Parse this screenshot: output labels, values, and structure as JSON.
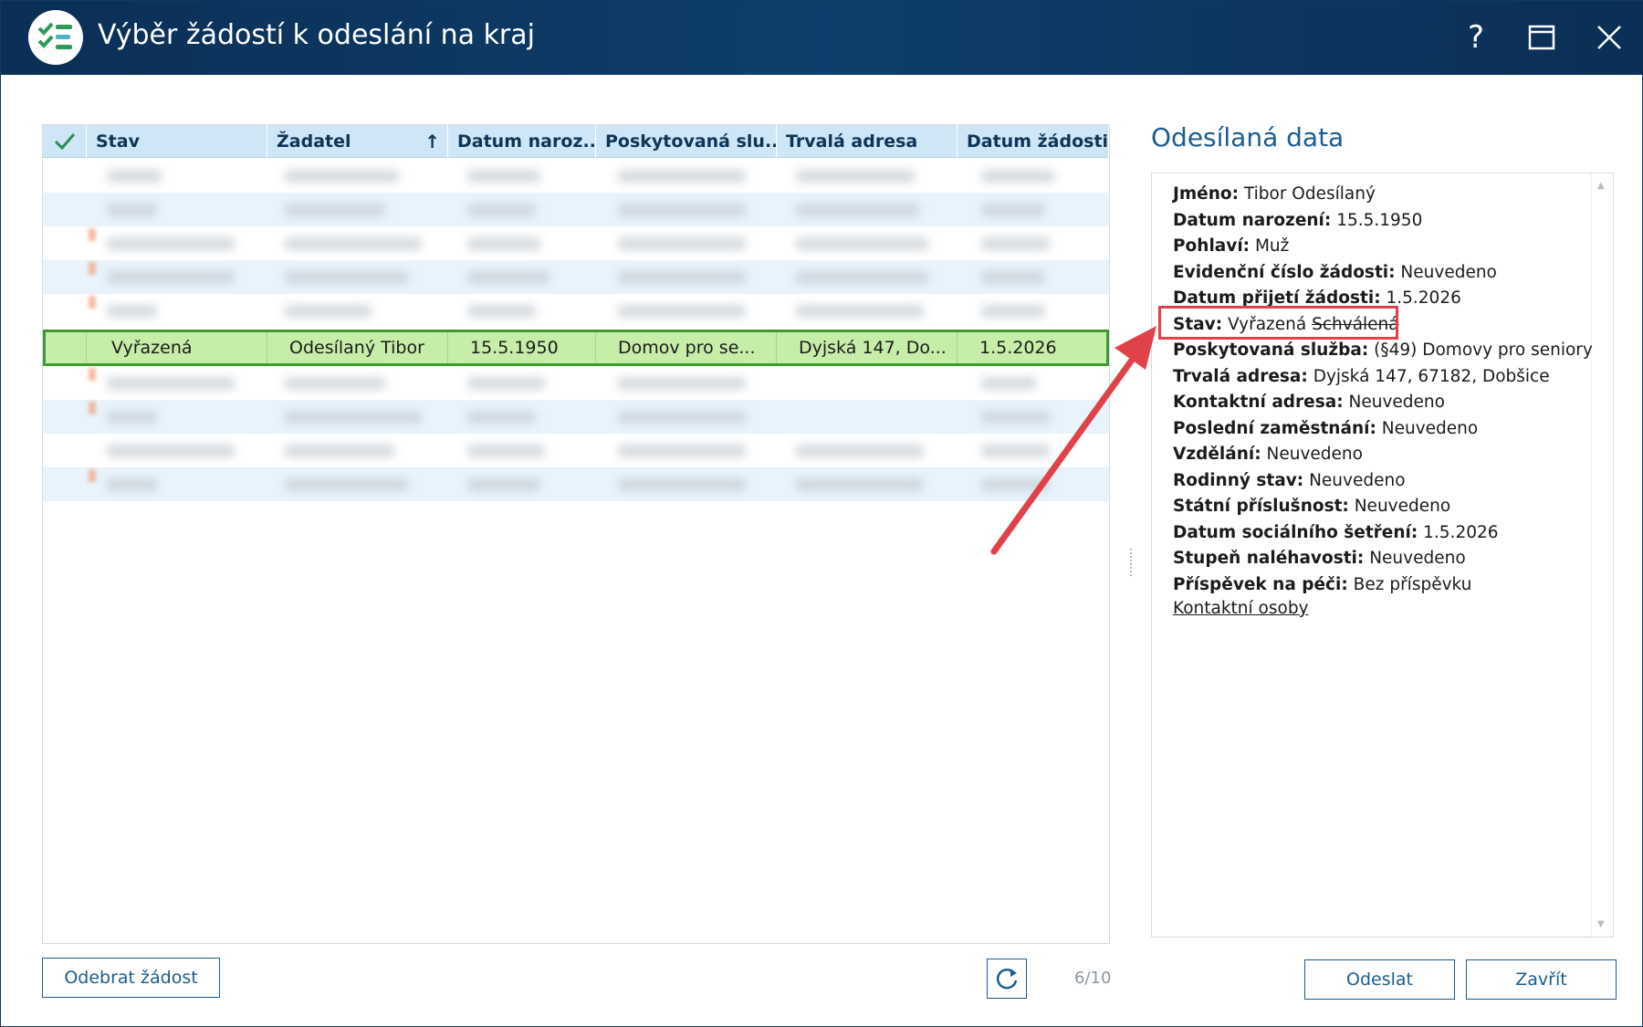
{
  "window": {
    "title": "Výběr žádostí k odeslání na kraj",
    "help_glyph": "?"
  },
  "grid": {
    "check_icon": "checkmark-icon",
    "columns": [
      "Stav",
      "Žadatel",
      "Datum naroz...",
      "Poskytovaná slu...",
      "Trvalá adresa",
      "Datum žádosti"
    ],
    "sort_glyph": "↑",
    "selected_row": {
      "stav": "Vyřazená",
      "zadatel": "Odesílaný Tibor",
      "datum_narozeni": "15.5.1950",
      "sluzba": "Domov pro se...",
      "adresa": "Dyjská 147, Do...",
      "datum_zadosti": "1.5.2026"
    }
  },
  "panel": {
    "title": "Odesílaná data",
    "fields": [
      {
        "label": "Jméno:",
        "value": "Tibor Odesílaný"
      },
      {
        "label": "Datum narození:",
        "value": "15.5.1950"
      },
      {
        "label": "Pohlaví:",
        "value": "Muž"
      },
      {
        "label": "Evidenční číslo žádosti:",
        "value": "Neuvedeno"
      },
      {
        "label": "Datum přijetí žádosti:",
        "value": "1.5.2026"
      },
      {
        "label": "Stav:",
        "value": "Vyřazená",
        "old_value": "Schválená"
      },
      {
        "label": "Poskytovaná služba:",
        "value": "(§49) Domovy pro seniory"
      },
      {
        "label": "Trvalá adresa:",
        "value": "Dyjská 147, 67182, Dobšice"
      },
      {
        "label": "Kontaktní adresa:",
        "value": "Neuvedeno"
      },
      {
        "label": "Poslední zaměstnání:",
        "value": "Neuvedeno"
      },
      {
        "label": "Vzdělání:",
        "value": "Neuvedeno"
      },
      {
        "label": "Rodinný stav:",
        "value": "Neuvedeno"
      },
      {
        "label": "Státní příslušnost:",
        "value": "Neuvedeno"
      },
      {
        "label": "Datum sociálního šetření:",
        "value": "1.5.2026"
      },
      {
        "label": "Stupeň naléhavosti:",
        "value": "Neuvedeno"
      },
      {
        "label": "Příspěvek na péči:",
        "value": "Bez příspěvku"
      }
    ],
    "contacts_link": "Kontaktní osoby"
  },
  "footer": {
    "remove_label": "Odebrat žádost",
    "refresh_icon": "refresh-icon",
    "counter": "6/10",
    "send_label": "Odeslat",
    "close_label": "Zavřít"
  },
  "colors": {
    "titlebar": "#0e3e6b",
    "header": "#cfe6f6",
    "selected_row": "#c7eea8",
    "annotation": "#e0424a",
    "accent": "#1a5d91"
  }
}
